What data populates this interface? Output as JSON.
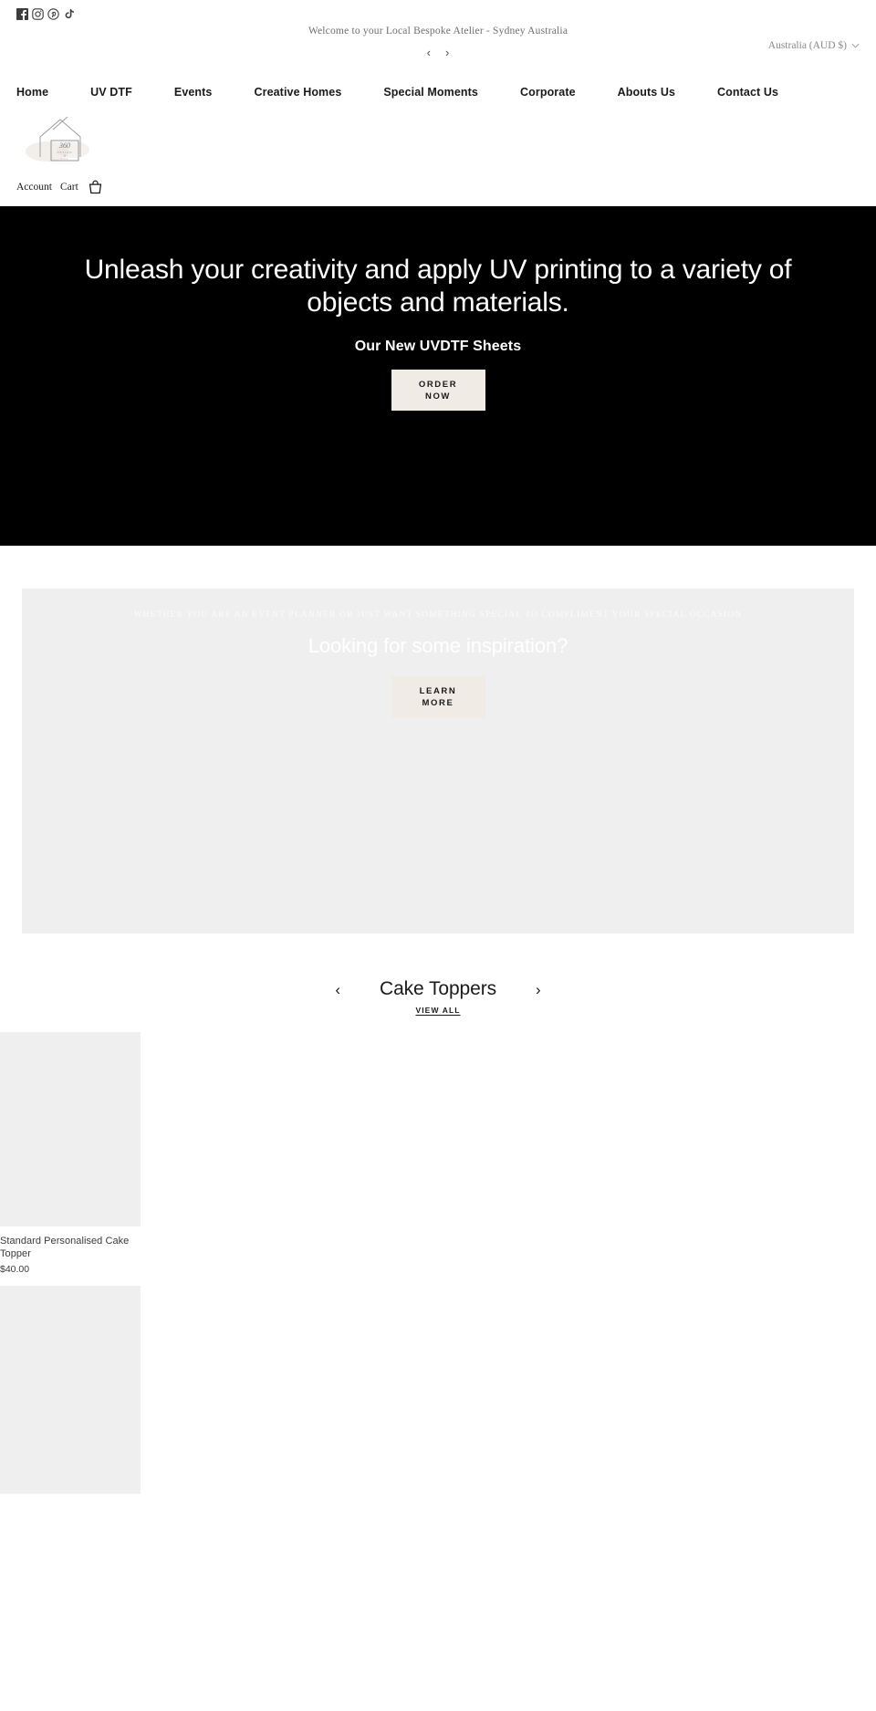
{
  "topbar": {
    "social": [
      {
        "name": "facebook-icon",
        "label": "Facebook"
      },
      {
        "name": "instagram-icon",
        "label": "Instagram"
      },
      {
        "name": "pinterest-icon",
        "label": "Pinterest"
      },
      {
        "name": "tiktok-icon",
        "label": "TikTok"
      }
    ],
    "announcement": "Welcome to your Local Bespoke Atelier - Sydney Australia",
    "prev_label": "‹",
    "next_label": "›",
    "currency": "Australia (AUD $)",
    "currency_chevron": "⌄"
  },
  "nav": {
    "items": [
      {
        "label": "Home"
      },
      {
        "label": "UV DTF"
      },
      {
        "label": "Events"
      },
      {
        "label": "Creative Homes"
      },
      {
        "label": "Special Moments"
      },
      {
        "label": "Corporate"
      },
      {
        "label": "Abouts Us"
      },
      {
        "label": "Contact Us"
      }
    ]
  },
  "logo": {
    "monogram": "360",
    "line1": "DESIGN",
    "line2": "&",
    "line3": "CUT"
  },
  "utility": {
    "account": "Account",
    "cart": "Cart",
    "cart_icon": "shopping-cart-icon"
  },
  "hero": {
    "heading": "Unleash your creativity and apply UV printing to a variety of objects and materials.",
    "subheading": "Our New UVDTF Sheets",
    "cta_line1": "ORDER",
    "cta_line2": "NOW"
  },
  "inspiration": {
    "eyebrow": "WHETHER YOU ARE AN EVENT PLANNER OR JUST WANT SOMETHING SPECIAL TO COMPLIMENT YOUR SPECIAL OCCASION",
    "heading": "Looking for some inspiration?",
    "cta_line1": "LEARN",
    "cta_line2": "MORE"
  },
  "collection": {
    "title": "Cake Toppers",
    "prev_label": "‹",
    "next_label": "›",
    "view_all": "VIEW ALL",
    "products": [
      {
        "title": "Standard Personalised Cake Topper",
        "price": "$40.00"
      },
      {
        "title": "",
        "price": ""
      }
    ]
  },
  "colors": {
    "hero_bg": "#000000",
    "cream_button": "#F0EBE5",
    "panel_gray": "#EFEFEF",
    "text": "#1a1a1a"
  }
}
